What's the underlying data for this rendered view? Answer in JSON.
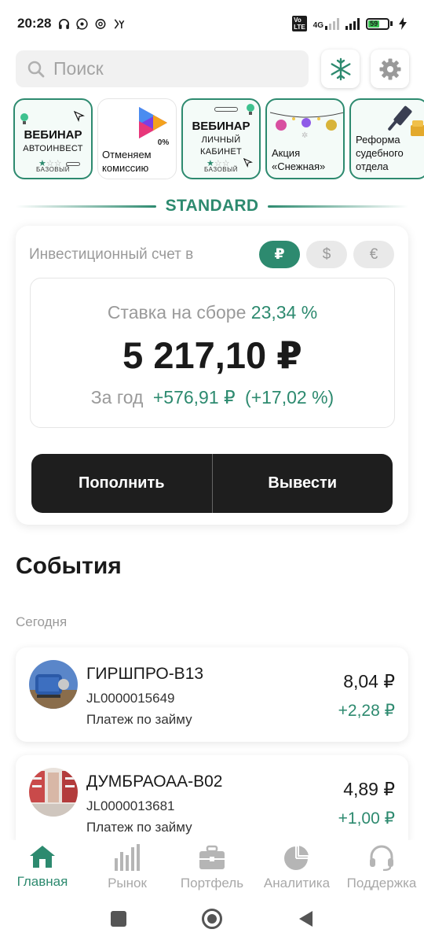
{
  "status": {
    "time": "20:28",
    "network": "4G",
    "battery": "59"
  },
  "search": {
    "placeholder": "Поиск"
  },
  "stories": [
    {
      "title": "ВЕБИНАР",
      "subtitle": "АВТОИНВЕСТ",
      "level": "БАЗОВЫЙ"
    },
    {
      "caption": "Отменяем комиссию",
      "badge": "0%"
    },
    {
      "title": "ВЕБИНАР",
      "subtitle": "ЛИЧНЫЙ КАБИНЕТ",
      "level": "БАЗОВЫЙ"
    },
    {
      "caption": "Акция «Снежная»"
    },
    {
      "caption": "Реформа судебного отдела"
    }
  ],
  "tier": {
    "label": "STANDARD"
  },
  "account": {
    "heading": "Инвестиционный счет в",
    "currencies": [
      "₽",
      "$",
      "€"
    ],
    "rate_label": "Ставка на сборе",
    "rate_value": "23,34 %",
    "balance": "5 217,10 ₽",
    "year_label": "За год",
    "year_change": "+576,91 ₽",
    "year_percent": "(+17,02 %)",
    "deposit_label": "Пополнить",
    "withdraw_label": "Вывести"
  },
  "events": {
    "title": "События",
    "group_label": "Сегодня",
    "items": [
      {
        "name": "ГИРШПРО-В13",
        "code": "JL0000015649",
        "kind": "Платеж по займу",
        "amount": "8,04 ₽",
        "delta": "+2,28 ₽"
      },
      {
        "name": "ДУМБРАОАА-В02",
        "code": "JL0000013681",
        "kind": "Платеж по займу",
        "amount": "4,89 ₽",
        "delta": "+1,00 ₽"
      }
    ]
  },
  "nav": {
    "items": [
      {
        "label": "Главная",
        "icon": "home-icon"
      },
      {
        "label": "Рынок",
        "icon": "market-bars-icon"
      },
      {
        "label": "Портфель",
        "icon": "briefcase-icon"
      },
      {
        "label": "Аналитика",
        "icon": "pie-chart-icon"
      },
      {
        "label": "Поддержка",
        "icon": "headset-icon"
      }
    ]
  },
  "colors": {
    "accent": "#2d8a6f",
    "dark_button": "#1e1e1e",
    "muted": "#9a9a9a"
  }
}
